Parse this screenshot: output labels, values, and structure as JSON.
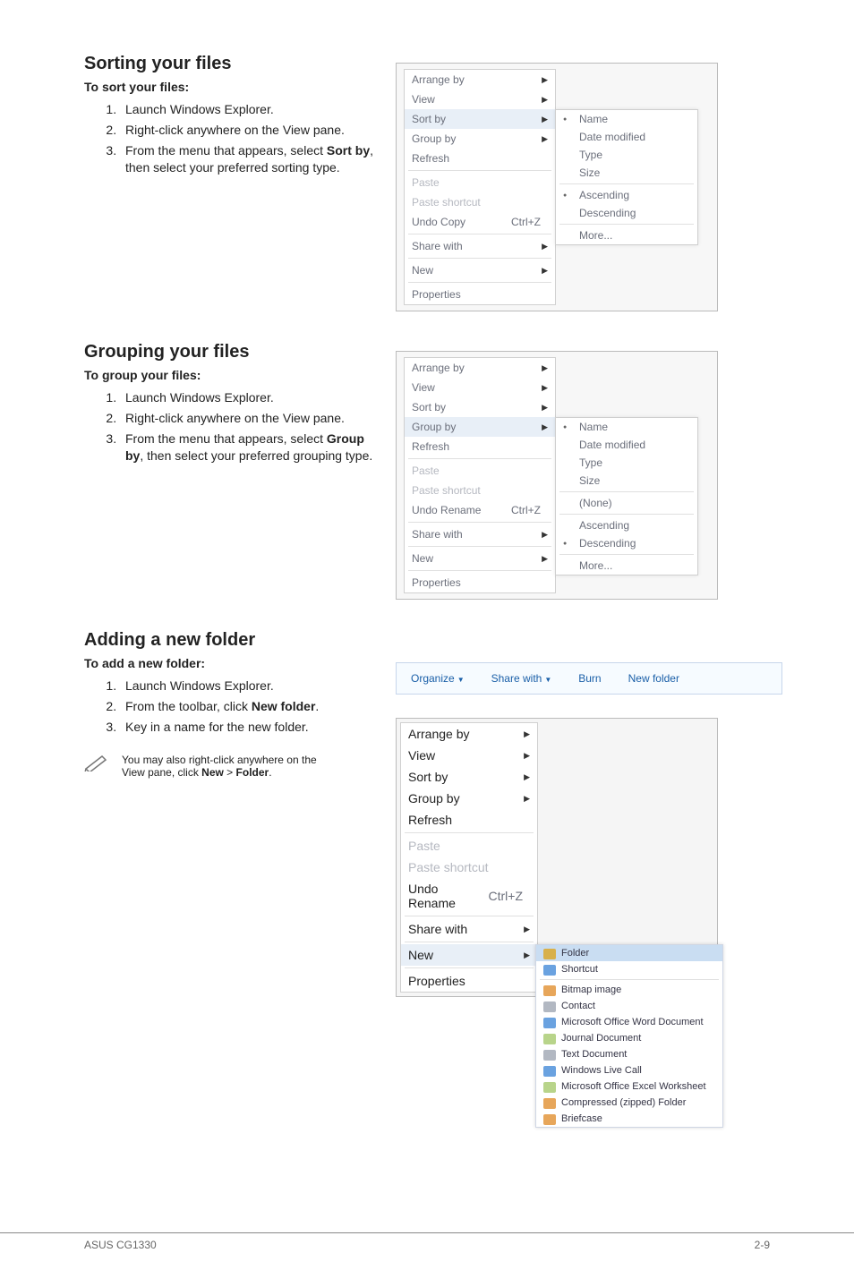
{
  "footer": {
    "left": "ASUS CG1330",
    "right": "2-9"
  },
  "sec1": {
    "title": "Sorting your files",
    "subtitle": "To sort your files:",
    "steps": [
      "Launch Windows Explorer.",
      "Right-click anywhere on the View pane.",
      "From the menu that appears, select Sort by, then select your preferred sorting type."
    ],
    "menu1": {
      "items": [
        "Arrange by",
        "View",
        "Sort by",
        "Group by",
        "Refresh",
        "Paste",
        "Paste shortcut",
        "Undo Copy",
        "Share with",
        "New",
        "Properties"
      ],
      "undoKey": "Ctrl+Z",
      "sub": [
        "Name",
        "Date modified",
        "Type",
        "Size",
        "Ascending",
        "Descending",
        "More..."
      ]
    }
  },
  "sec2": {
    "title": "Grouping your files",
    "subtitle": "To group your files:",
    "steps": [
      "Launch Windows Explorer.",
      "Right-click anywhere on the View pane.",
      "From the menu that appears, select Group by, then select your preferred grouping type."
    ],
    "menu2": {
      "items": [
        "Arrange by",
        "View",
        "Sort by",
        "Group by",
        "Refresh",
        "Paste",
        "Paste shortcut",
        "Undo Rename",
        "Share with",
        "New",
        "Properties"
      ],
      "undoKey": "Ctrl+Z",
      "sub": [
        "Name",
        "Date modified",
        "Type",
        "Size",
        "(None)",
        "Ascending",
        "Descending",
        "More..."
      ]
    }
  },
  "sec3": {
    "title": "Adding a new folder",
    "subtitle": "To add a new folder:",
    "steps": [
      "Launch Windows Explorer.",
      "From the toolbar, click New folder.",
      "Key in a name for the new folder."
    ],
    "toolbar": [
      "Organize",
      "Share with",
      "Burn",
      "New folder"
    ],
    "note": "You may also right-click anywhere on the View pane, click New > Folder.",
    "menu3": {
      "items": [
        "Arrange by",
        "View",
        "Sort by",
        "Group by",
        "Refresh",
        "Paste",
        "Paste shortcut",
        "Undo Rename",
        "Share with",
        "New",
        "Properties"
      ],
      "undoKey": "Ctrl+Z",
      "sub": [
        "Folder",
        "Shortcut",
        "Bitmap image",
        "Contact",
        "Microsoft Office Word Document",
        "Journal Document",
        "Text Document",
        "Windows Live Call",
        "Microsoft Office Excel Worksheet",
        "Compressed (zipped) Folder",
        "Briefcase"
      ]
    }
  }
}
